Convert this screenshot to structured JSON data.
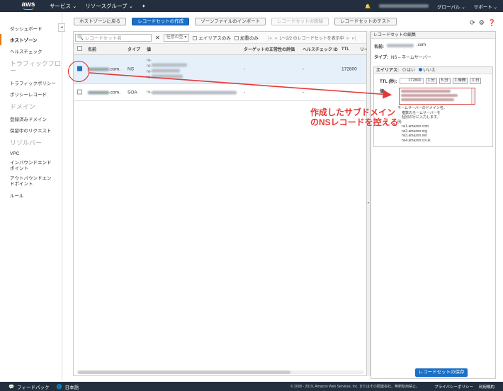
{
  "topnav": {
    "logo": "aws",
    "services": "サービス ⌄",
    "resource_groups": "リソースグループ ⌄",
    "pin": "✦",
    "region": "グローバル ⌄",
    "support": "サポート ⌄"
  },
  "sidebar": {
    "items": [
      {
        "label": "ダッシュボード"
      },
      {
        "label": "ホストゾーン"
      },
      {
        "label": "ヘルスチェック"
      }
    ],
    "traffic_head": "トラフィックフロー",
    "traffic_items": [
      {
        "label": "トラフィックポリシー"
      },
      {
        "label": "ポリシーレコード"
      }
    ],
    "domain_head": "ドメイン",
    "domain_items": [
      {
        "label": "登録済みドメイン"
      },
      {
        "label": "保留中のリクエスト"
      }
    ],
    "resolver_head": "リゾルバー",
    "resolver_items": [
      {
        "label": "VPC"
      },
      {
        "label": "インバウンドエンドポイント"
      },
      {
        "label": "アウトバウンドエンドポイント"
      },
      {
        "label": "ルール"
      }
    ]
  },
  "toolbar": {
    "back": "ホストゾーンに戻る",
    "create": "レコードセットの作成",
    "import": "ゾーンファイルのインポート",
    "delete": "レコードセットの削除",
    "test": "レコードセットのテスト"
  },
  "filter": {
    "search_placeholder": "レコードセット名",
    "type_select": "任意の型 ▾",
    "alias_only": "エイリアスのみ",
    "weighted_only": "加重のみ",
    "pager": "1～2/2 のレコードセットを表示中"
  },
  "table": {
    "headers": {
      "name": "名前",
      "type": "タイプ",
      "value": "値",
      "eval": "ターゲットの正常性の評価",
      "health": "ヘルスチェック ID",
      "ttl": "TTL",
      "region": "リー"
    },
    "rows": [
      {
        "name_suffix": ".com.",
        "type": "NS",
        "value": "ns-",
        "eval": "-",
        "health": "-",
        "ttl": "172800"
      },
      {
        "name_suffix": ".com.",
        "type": "SOA",
        "value": "ns-",
        "eval": "-",
        "health": "-",
        "ttl": ""
      }
    ]
  },
  "edit_panel": {
    "title": "レコードセットの編集",
    "name_label": "名前:",
    "name_value": ".com",
    "type_label": "タイプ:",
    "type_value": "NS – ネームサーバー",
    "alias_label": "エイリアス:",
    "alias_yes": "はい",
    "alias_no": "いいえ",
    "ttl_label": "TTL (秒):",
    "ttl_value": "172800",
    "ttl_buttons": [
      "1 分",
      "5 分",
      "1 時間",
      "1 日"
    ],
    "value_label": "値:",
    "help_lines": [
      "ネームサーバーのドメイン名。",
      "複数のネームサーバーを",
      "個別の行に入力します。",
      "例:",
      "ns1.amazon.com",
      "ns2.amazon.org",
      "ns3.amazon.net",
      "ns4.amazon.co.uk"
    ],
    "save": "レコードセットの保存"
  },
  "annotation": {
    "line1": "作成したサブドメイン",
    "line2": "のNSレコードを控える"
  },
  "footer": {
    "feedback": "フィードバック",
    "language": "日本語",
    "copyright": "© 2008 - 2019, Amazon Web Services, Inc. またはその関連会社。無断転用禁止。",
    "privacy": "プライバシーポリシー",
    "terms": "利用規約"
  },
  "colors": {
    "nav_bg": "#232f3e",
    "primary": "#1b6fc5",
    "annotation": "#e53935",
    "logo_accent": "#ff9900"
  }
}
